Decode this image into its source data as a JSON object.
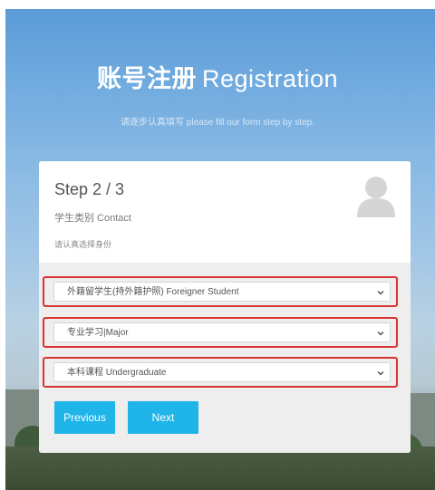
{
  "hero": {
    "title_cn": "账号注册",
    "title_en": "Registration",
    "subtitle": "请逐步认真填写 please fill our form step by step."
  },
  "card": {
    "step": "Step 2 / 3",
    "section": "学生类别 Contact",
    "hint": "请认真选择身份",
    "avatar_icon": "user-silhouette-icon"
  },
  "form": {
    "student_type": "外籍留学生(持外籍护照) Foreigner Student",
    "study_type": "专业学习|Major",
    "course_level": "本科课程 Undergraduate"
  },
  "buttons": {
    "previous": "Previous",
    "next": "Next"
  },
  "colors": {
    "accent": "#1fb5e8",
    "highlight": "#d9342f",
    "panel": "#eeeeee"
  }
}
